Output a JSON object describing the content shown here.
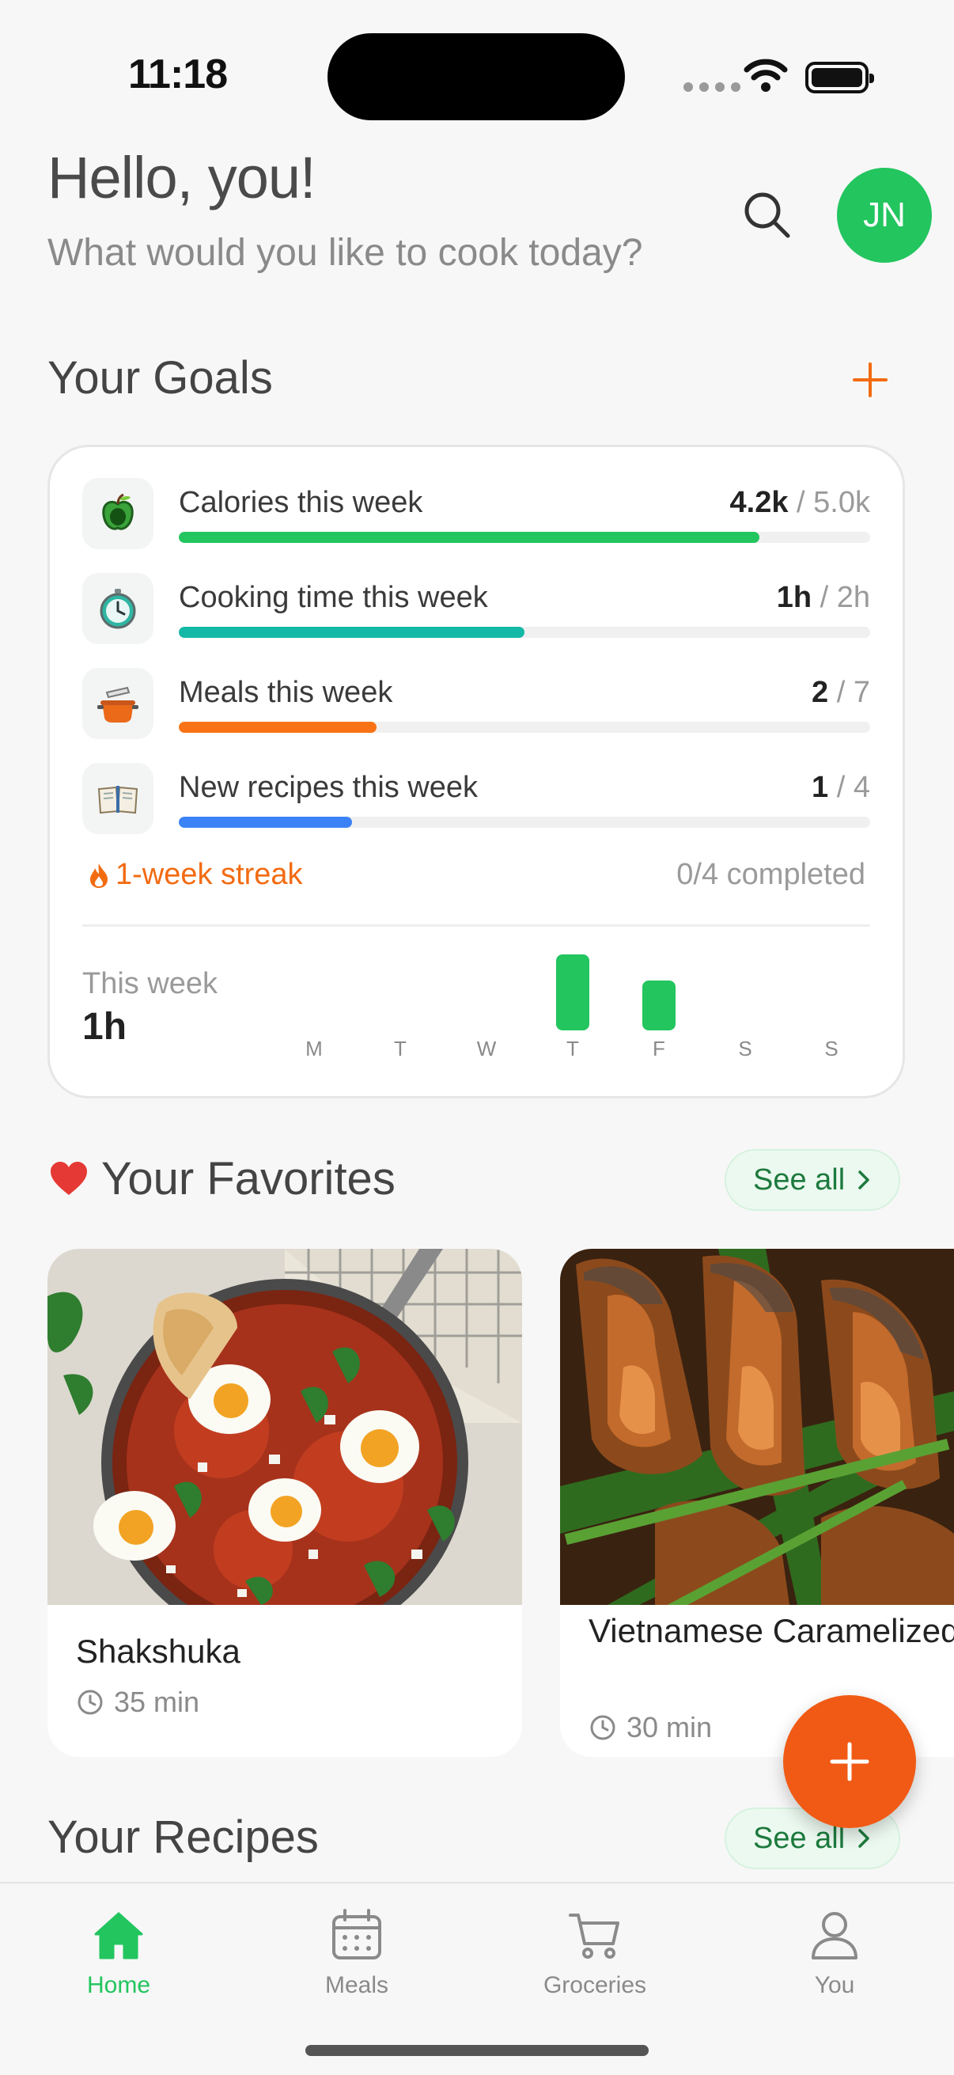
{
  "status_bar": {
    "time": "11:18"
  },
  "header": {
    "greeting": "Hello, you!",
    "subtitle": "What would you like to cook today?",
    "avatar_initials": "JN",
    "avatar_color": "#22C55E"
  },
  "goals": {
    "title": "Your Goals",
    "items": [
      {
        "label": "Calories this week",
        "current": "4.2k",
        "target": "/ 5.0k",
        "progress": 0.84,
        "color": "#22C55E",
        "icon": "apple-icon"
      },
      {
        "label": "Cooking time this week",
        "current": "1h",
        "target": "/ 2h",
        "progress": 0.5,
        "color": "#14B8A6",
        "icon": "stopwatch-icon"
      },
      {
        "label": "Meals this week",
        "current": "2",
        "target": "/ 7",
        "progress": 0.286,
        "color": "#F97316",
        "icon": "cooking-pot-icon"
      },
      {
        "label": "New recipes this week",
        "current": "1",
        "target": "/ 4",
        "progress": 0.25,
        "color": "#3B82F6",
        "icon": "open-book-icon"
      }
    ],
    "streak": "1-week streak",
    "completed": "0/4 completed",
    "week_label": "This week",
    "week_value": "1h",
    "days": [
      "M",
      "T",
      "W",
      "T",
      "F",
      "S",
      "S"
    ]
  },
  "chart_data": {
    "type": "bar",
    "categories": [
      "M",
      "T",
      "W",
      "T",
      "F",
      "S",
      "S"
    ],
    "values": [
      0,
      0,
      0,
      35,
      23,
      0,
      0
    ],
    "ylabel": "",
    "xlabel": ""
  },
  "favorites": {
    "title": "Your Favorites",
    "see_all": "See all",
    "recipes": [
      {
        "title": "Shakshuka",
        "time": "35 min"
      },
      {
        "title": "Vietnamese Caramelized Braised S",
        "time": "30 min"
      }
    ]
  },
  "recipes": {
    "title": "Your Recipes",
    "see_all": "See all"
  },
  "tabs": [
    {
      "label": "Home",
      "active": true
    },
    {
      "label": "Meals",
      "active": false
    },
    {
      "label": "Groceries",
      "active": false
    },
    {
      "label": "You",
      "active": false
    }
  ],
  "colors": {
    "accent": "#22C55E",
    "fab": "#F15A14",
    "streak": "#F26B11"
  }
}
